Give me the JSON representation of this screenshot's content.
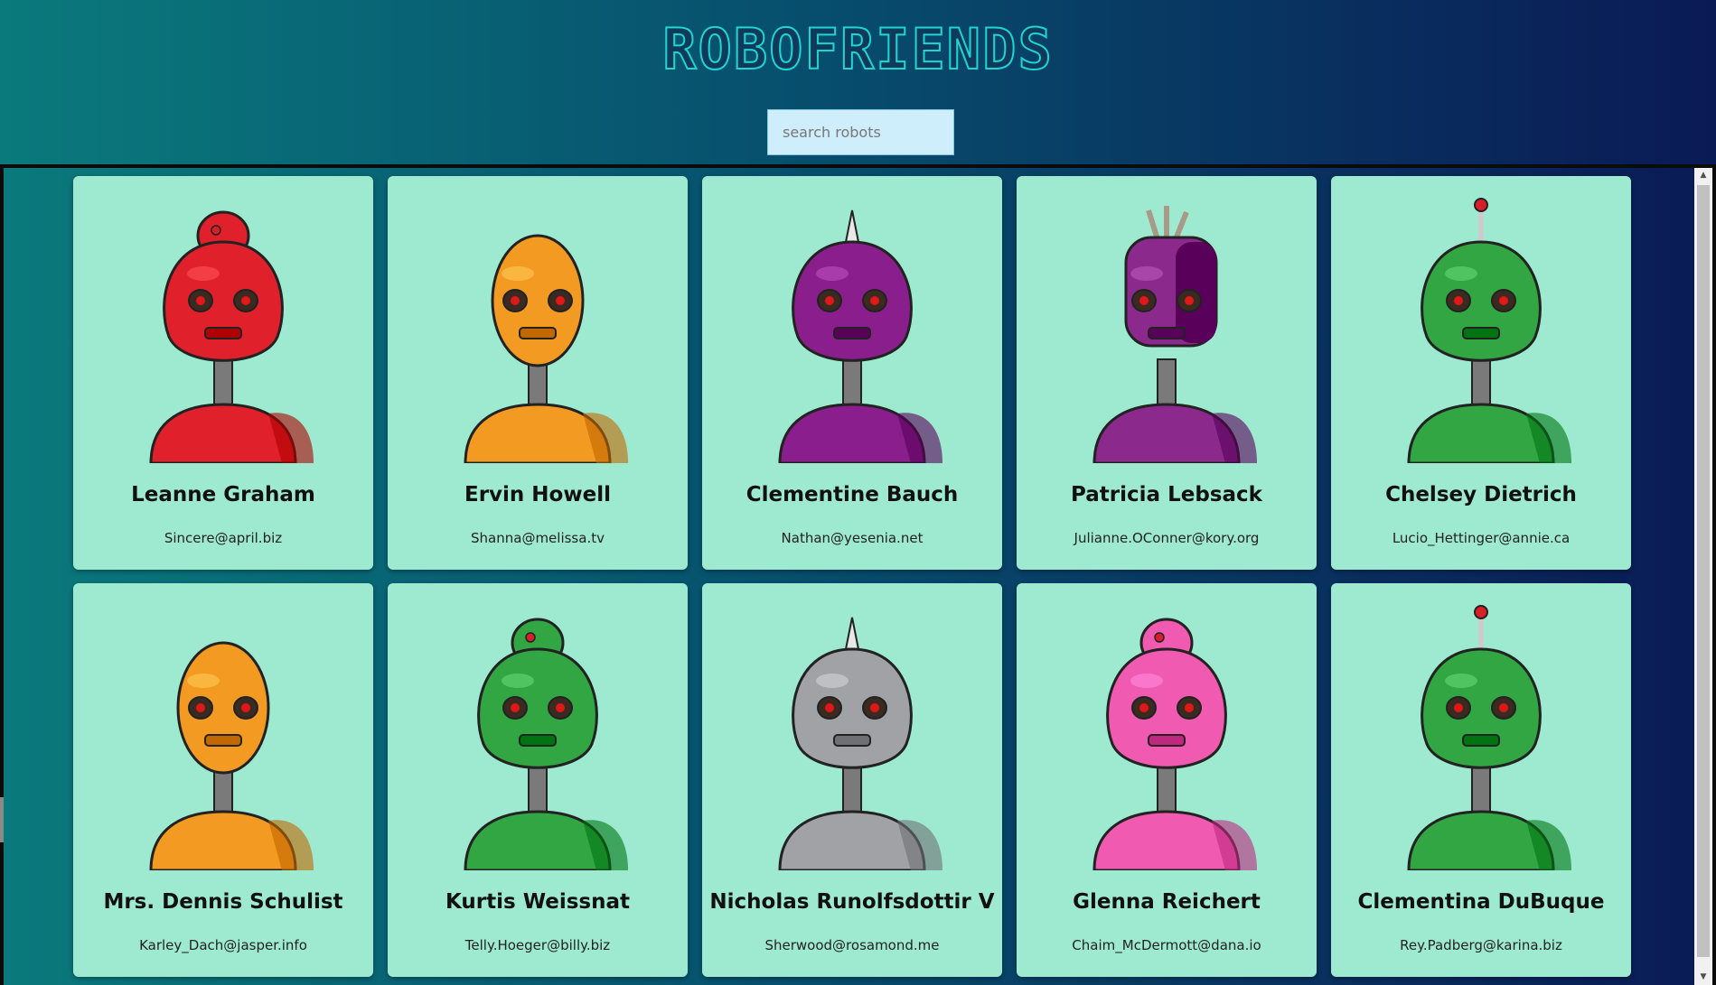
{
  "app": {
    "logo_text": "ROBOFRIENDS"
  },
  "search": {
    "placeholder": "search robots",
    "value": ""
  },
  "robots": [
    {
      "name": "Leanne Graham",
      "email": "Sincere@april.biz",
      "color": "#e0202a",
      "head": "dome"
    },
    {
      "name": "Ervin Howell",
      "email": "Shanna@melissa.tv",
      "color": "#f39a22",
      "head": "oval"
    },
    {
      "name": "Clementine Bauch",
      "email": "Nathan@yesenia.net",
      "color": "#8a1e8c",
      "head": "spike"
    },
    {
      "name": "Patricia Lebsack",
      "email": "Julianne.OConner@kory.org",
      "color": "#8b2a8c",
      "head": "box"
    },
    {
      "name": "Chelsey Dietrich",
      "email": "Lucio_Hettinger@annie.ca",
      "color": "#32a642",
      "head": "antenna"
    },
    {
      "name": "Mrs. Dennis Schulist",
      "email": "Karley_Dach@jasper.info",
      "color": "#f39a22",
      "head": "oval"
    },
    {
      "name": "Kurtis Weissnat",
      "email": "Telly.Hoeger@billy.biz",
      "color": "#32a642",
      "head": "dome"
    },
    {
      "name": "Nicholas Runolfsdottir V",
      "email": "Sherwood@rosamond.me",
      "color": "#a0a2a6",
      "head": "spike"
    },
    {
      "name": "Glenna Reichert",
      "email": "Chaim_McDermott@dana.io",
      "color": "#f05ab0",
      "head": "dome"
    },
    {
      "name": "Clementina DuBuque",
      "email": "Rey.Padberg@karina.biz",
      "color": "#32a642",
      "head": "antenna"
    }
  ]
}
